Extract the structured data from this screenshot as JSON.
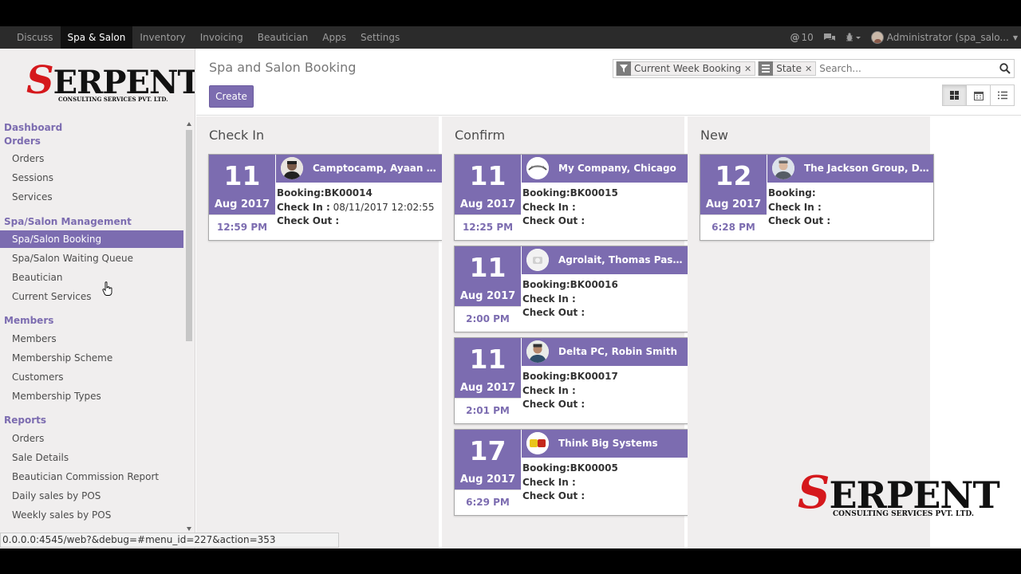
{
  "topnav": {
    "menu": [
      "Discuss",
      "Spa & Salon",
      "Inventory",
      "Invoicing",
      "Beautician",
      "Apps",
      "Settings"
    ],
    "active": "Spa & Salon",
    "messages_count": "10",
    "user": "Administrator (spa_salo..."
  },
  "logo": {
    "main": "ERPENT",
    "initial": "S",
    "tagline": "CONSULTING SERVICES PVT. LTD."
  },
  "sidebar": {
    "sections": [
      {
        "title": "Dashboard"
      },
      {
        "title": "Orders",
        "items": [
          "Orders",
          "Sessions",
          "Services"
        ]
      },
      {
        "title": "Spa/Salon Management",
        "items": [
          "Spa/Salon Booking",
          "Spa/Salon Waiting Queue",
          "Beautician",
          "Current Services"
        ]
      },
      {
        "title": "Members",
        "items": [
          "Members",
          "Membership Scheme",
          "Customers",
          "Membership Types"
        ]
      },
      {
        "title": "Reports",
        "items": [
          "Orders",
          "Sale Details",
          "Beautician Commission Report",
          "Daily sales by POS",
          "Weekly sales by POS"
        ]
      }
    ],
    "active_item": "Spa/Salon Booking"
  },
  "control_panel": {
    "title": "Spa and Salon Booking",
    "create_label": "Create",
    "facets": [
      {
        "icon": "filter-icon",
        "label": "Current Week Booking"
      },
      {
        "icon": "group-by-icon",
        "label": "State"
      }
    ],
    "search_placeholder": "Search..."
  },
  "columns": [
    {
      "title": "Check In",
      "cards": [
        {
          "day": "11",
          "month_year": "Aug 2017",
          "time": "12:59 PM",
          "customer": "Camptocamp, Ayaan A...",
          "booking": "Booking:BK00014",
          "check_in_label": "Check In :",
          "check_in_value": "08/11/2017 12:02:55",
          "check_out_label": "Check Out :"
        }
      ]
    },
    {
      "title": "Confirm",
      "cards": [
        {
          "day": "11",
          "month_year": "Aug 2017",
          "time": "12:25 PM",
          "customer": "My Company, Chicago",
          "booking": "Booking:BK00015",
          "check_in_label": "Check In :",
          "check_in_value": "",
          "check_out_label": "Check Out :"
        },
        {
          "day": "11",
          "month_year": "Aug 2017",
          "time": "2:00 PM",
          "customer": "Agrolait, Thomas Passot",
          "booking": "Booking:BK00016",
          "check_in_label": "Check In :",
          "check_in_value": "",
          "check_out_label": "Check Out :"
        },
        {
          "day": "11",
          "month_year": "Aug 2017",
          "time": "2:01 PM",
          "customer": "Delta PC, Robin Smith",
          "booking": "Booking:BK00017",
          "check_in_label": "Check In :",
          "check_in_value": "",
          "check_out_label": "Check Out :"
        },
        {
          "day": "17",
          "month_year": "Aug 2017",
          "time": "6:29 PM",
          "customer": "Think Big Systems",
          "booking": "Booking:BK00005",
          "check_in_label": "Check In :",
          "check_in_value": "",
          "check_out_label": "Check Out :"
        }
      ]
    },
    {
      "title": "New",
      "cards": [
        {
          "day": "12",
          "month_year": "Aug 2017",
          "time": "6:28 PM",
          "customer": "The Jackson Group, Da...",
          "booking": "Booking:",
          "check_in_label": "Check In :",
          "check_in_value": "",
          "check_out_label": "Check Out :"
        }
      ]
    }
  ],
  "status_url": "0.0.0.0:4545/web?&debug=#menu_id=227&action=353",
  "colors": {
    "primary": "#7c6cb0",
    "nav_bg": "#2b2b2b",
    "logo_red": "#d5181c"
  }
}
